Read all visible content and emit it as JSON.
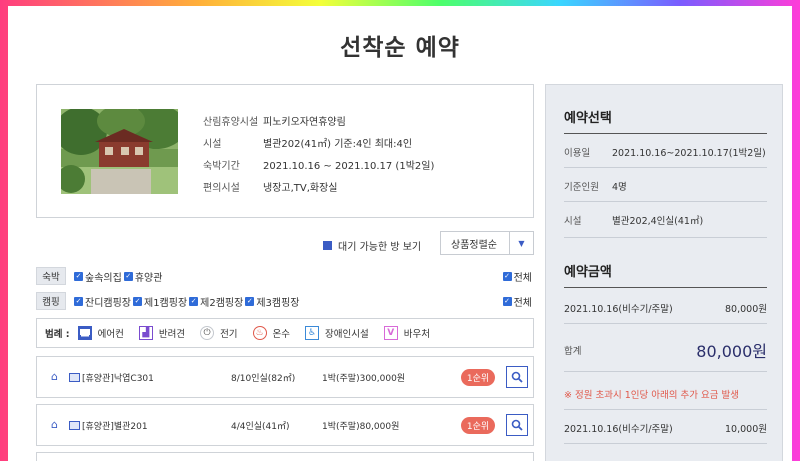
{
  "page_title": "선착순 예약",
  "facility_info": [
    {
      "key": "산림휴양시설",
      "value": "피노키오자연휴양림"
    },
    {
      "key": "시설",
      "value": "별관202(41㎡) 기준:4인 최대:4인"
    },
    {
      "key": "숙박기간",
      "value": "2021.10.16 ~ 2021.10.17 (1박2일)"
    },
    {
      "key": "편의시설",
      "value": "냉장고,TV,화장실"
    }
  ],
  "availability_label": "대기 가능한 방 보기",
  "sort": {
    "selected": "상품정렬순"
  },
  "filters": {
    "lodging": {
      "tag": "숙박",
      "options": [
        "숲속의집",
        "휴양관"
      ],
      "all": "전체"
    },
    "camping": {
      "tag": "캠핑",
      "options": [
        "잔디캠핑장",
        "제1캠핑장",
        "제2캠핑장",
        "제3캠핑장"
      ],
      "all": "전체"
    }
  },
  "legend": {
    "title": "범례 :",
    "items": [
      {
        "label": "에어컨",
        "icon": "air-conditioner-icon"
      },
      {
        "label": "반려견",
        "icon": "pet-icon"
      },
      {
        "label": "전기",
        "icon": "electric-icon"
      },
      {
        "label": "온수",
        "icon": "hot-water-icon"
      },
      {
        "label": "장애인시설",
        "icon": "accessibility-icon"
      },
      {
        "label": "바우처",
        "icon": "voucher-icon"
      }
    ]
  },
  "rooms": [
    {
      "name": "[휴양관]낙엽C301",
      "capacity": "8/10인실(82㎡)",
      "price": "1박(주말)300,000원",
      "rank": "1순위"
    },
    {
      "name": "[휴양관]별관201",
      "capacity": "4/4인실(41㎡)",
      "price": "1박(주말)80,000원",
      "rank": "1순위"
    }
  ],
  "summary": {
    "selection_title": "예약선택",
    "rows": [
      {
        "key": "이용일",
        "value": "2021.10.16~2021.10.17(1박2일)"
      },
      {
        "key": "기준인원",
        "value": "4명"
      },
      {
        "key": "시설",
        "value": "별관202,4인실(41㎡)"
      }
    ],
    "amount_title": "예약금액",
    "price_line": {
      "label": "2021.10.16(비수기/주말)",
      "value": "80,000원"
    },
    "total": {
      "label": "합계",
      "value": "80,000원"
    },
    "notice": "※ 정원 초과시 1인당 아래의 추가 요금 발생",
    "extra_line": {
      "label": "2021.10.16(비수기/주말)",
      "value": "10,000원"
    }
  },
  "colors": {
    "accent": "#3b5cc4",
    "rank_badge": "#ea6a5c",
    "notice": "#e0584a",
    "total": "#2b2f6b"
  }
}
